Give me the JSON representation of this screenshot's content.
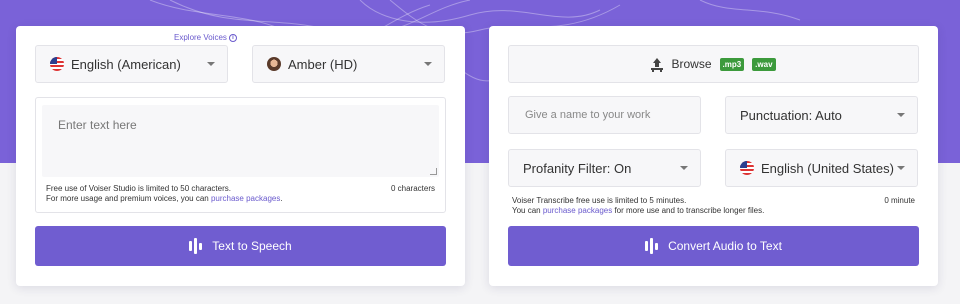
{
  "tts": {
    "explore_voices": "Explore Voices",
    "language_select": {
      "value": "English (American)",
      "icon": "us-flag-icon"
    },
    "voice_select": {
      "value": "Amber (HD)",
      "icon": "avatar-icon"
    },
    "text_input": {
      "placeholder": "Enter text here",
      "value": ""
    },
    "notice_line1": "Free use of Voiser Studio is limited to 50 characters.",
    "notice_line2_prefix": "For more usage and premium voices, you can ",
    "notice_link": "purchase packages",
    "notice_line2_suffix": ".",
    "char_count": "0 characters",
    "action_label": "Text to Speech"
  },
  "stt": {
    "browse_label": "Browse",
    "formats": [
      ".mp3",
      ".wav"
    ],
    "name_input": {
      "placeholder": "Give a name to your work",
      "value": ""
    },
    "punctuation_select": {
      "value": "Punctuation: Auto"
    },
    "profanity_select": {
      "value": "Profanity Filter: On"
    },
    "language_select": {
      "value": "English (United States)",
      "icon": "us-flag-icon"
    },
    "notice_line1": "Voiser Transcribe free use is limited to 5 minutes.",
    "notice_line2_prefix": "You can ",
    "notice_link": "purchase packages",
    "notice_line2_suffix": " for more use and to transcribe longer files.",
    "minute_count": "0 minute",
    "action_label": "Convert Audio to Text"
  },
  "colors": {
    "brand_purple": "#7a62d8",
    "button_purple": "#705dd0",
    "format_badge_green": "#3c9a3c"
  }
}
